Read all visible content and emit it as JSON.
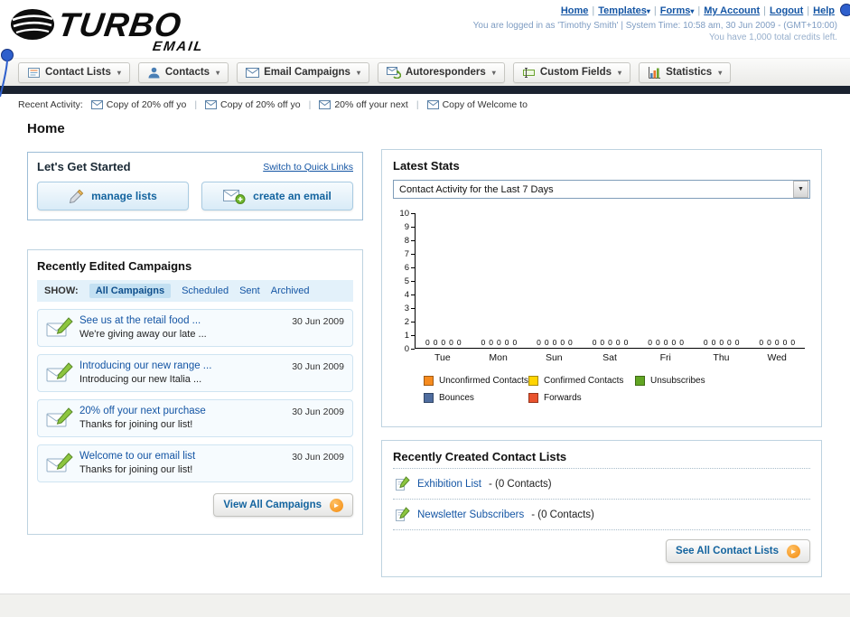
{
  "header": {
    "logo_text": "TURBO",
    "logo_sub": "EMAIL",
    "top_links": [
      {
        "label": "Home"
      },
      {
        "label": "Templates",
        "dropdown": true
      },
      {
        "label": "Forms",
        "dropdown": true
      },
      {
        "label": "My Account"
      },
      {
        "label": "Logout"
      },
      {
        "label": "Help"
      }
    ],
    "login_info": "You are logged in as 'Timothy Smith' | System Time: 10:58 am, 30 Jun 2009 - (GMT+10:00)",
    "credits_info": "You have 1,000 total credits left."
  },
  "nav": {
    "tabs": [
      {
        "label": "Contact Lists",
        "icon": "contact-lists-icon"
      },
      {
        "label": "Contacts",
        "icon": "contacts-icon"
      },
      {
        "label": "Email Campaigns",
        "icon": "email-campaigns-icon"
      },
      {
        "label": "Autoresponders",
        "icon": "autoresponders-icon"
      },
      {
        "label": "Custom Fields",
        "icon": "custom-fields-icon"
      },
      {
        "label": "Statistics",
        "icon": "statistics-icon"
      }
    ]
  },
  "recent_activity": {
    "label": "Recent Activity:",
    "items": [
      "Copy of 20% off yo",
      "Copy of 20% off yo",
      "20% off your next",
      "Copy of Welcome to"
    ]
  },
  "page_title": "Home",
  "get_started": {
    "title": "Let's Get Started",
    "switch_link": "Switch to Quick Links",
    "buttons": [
      {
        "label": "manage lists"
      },
      {
        "label": "create an email"
      }
    ]
  },
  "campaigns": {
    "title": "Recently Edited Campaigns",
    "show_label": "SHOW:",
    "filters": [
      "All Campaigns",
      "Scheduled",
      "Sent",
      "Archived"
    ],
    "active_filter": "All Campaigns",
    "items": [
      {
        "title": "See us at the retail food ...",
        "subtitle": "We're giving away our late ...",
        "date": "30 Jun 2009"
      },
      {
        "title": "Introducing our new range ...",
        "subtitle": "Introducing our new Italia ...",
        "date": "30 Jun 2009"
      },
      {
        "title": "20% off your next purchase",
        "subtitle": "Thanks for joining our list!",
        "date": "30 Jun 2009"
      },
      {
        "title": "Welcome to our email list",
        "subtitle": "Thanks for joining our list!",
        "date": "30 Jun 2009"
      }
    ],
    "view_all": "View All Campaigns"
  },
  "stats": {
    "title": "Latest Stats",
    "dropdown_value": "Contact Activity for the Last 7 Days",
    "chart_data": {
      "type": "bar",
      "title": "Contact Activity for the Last 7 Days",
      "categories": [
        "Tue",
        "Mon",
        "Sun",
        "Sat",
        "Fri",
        "Thu",
        "Wed"
      ],
      "series": [
        {
          "name": "Unconfirmed Contacts",
          "color": "#f68b1f",
          "values": [
            0,
            0,
            0,
            0,
            0,
            0,
            0
          ]
        },
        {
          "name": "Confirmed Contacts",
          "color": "#ffd400",
          "values": [
            0,
            0,
            0,
            0,
            0,
            0,
            0
          ]
        },
        {
          "name": "Unsubscribes",
          "color": "#61a523",
          "values": [
            0,
            0,
            0,
            0,
            0,
            0,
            0
          ]
        },
        {
          "name": "Bounces",
          "color": "#4f6d9f",
          "values": [
            0,
            0,
            0,
            0,
            0,
            0,
            0
          ]
        },
        {
          "name": "Forwards",
          "color": "#e9532e",
          "values": [
            0,
            0,
            0,
            0,
            0,
            0,
            0
          ]
        }
      ],
      "ylim": [
        0,
        10
      ],
      "grid": false,
      "legend_position": "bottom"
    },
    "legend": [
      {
        "label": "Unconfirmed Contacts",
        "color": "#f68b1f"
      },
      {
        "label": "Confirmed Contacts",
        "color": "#ffd400"
      },
      {
        "label": "Unsubscribes",
        "color": "#61a523"
      },
      {
        "label": "Bounces",
        "color": "#4f6d9f"
      },
      {
        "label": "Forwards",
        "color": "#e9532e"
      }
    ]
  },
  "contact_lists": {
    "title": "Recently Created Contact Lists",
    "items": [
      {
        "name": "Exhibition List",
        "suffix": " - (0 Contacts)"
      },
      {
        "name": "Newsletter Subscribers",
        "suffix": " - (0 Contacts)"
      }
    ],
    "see_all": "See All Contact Lists"
  }
}
